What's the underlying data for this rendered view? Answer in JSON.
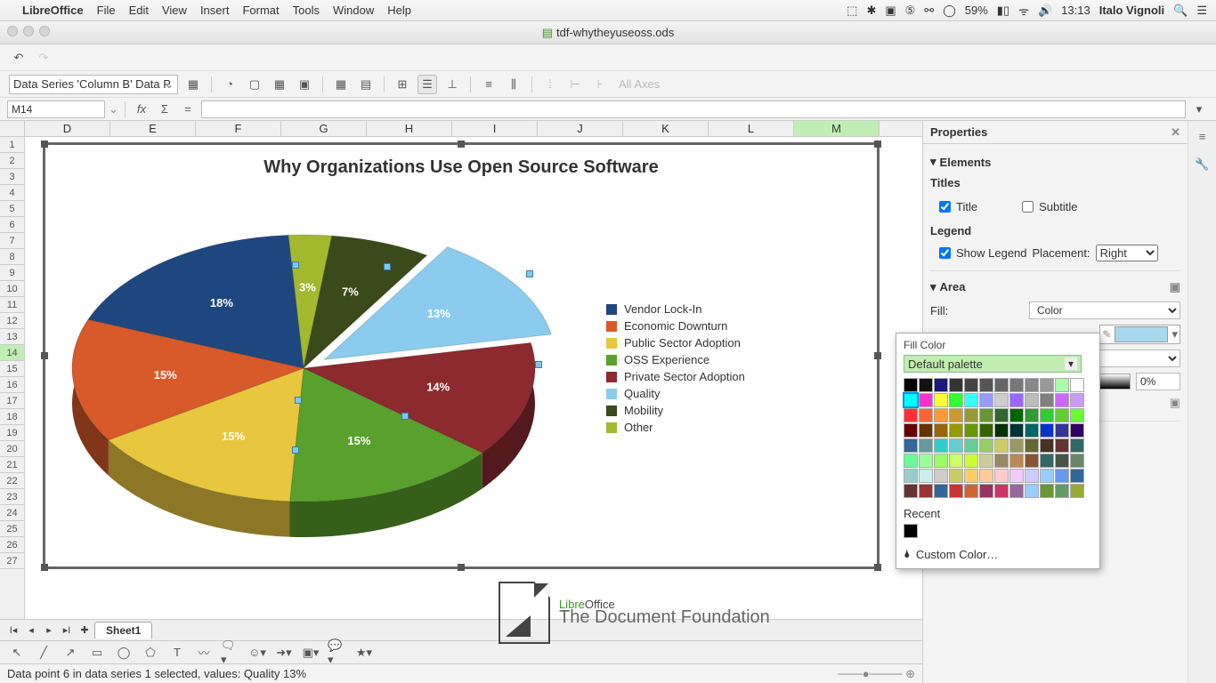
{
  "mac_menu": {
    "app": "LibreOffice",
    "items": [
      "File",
      "Edit",
      "View",
      "Insert",
      "Format",
      "Tools",
      "Window",
      "Help"
    ],
    "battery": "59%",
    "clock": "13:13",
    "user": "Italo Vignoli"
  },
  "window": {
    "title": "tdf-whytheyuseoss.ods"
  },
  "toolbar": {
    "series_combo": "Data Series 'Column B' Data P",
    "axes_label": "All Axes"
  },
  "cellref": {
    "cell": "M14"
  },
  "columns": [
    "D",
    "E",
    "F",
    "G",
    "H",
    "I",
    "J",
    "K",
    "L",
    "M"
  ],
  "active_col": "M",
  "rows_count": 27,
  "active_row": 14,
  "sidebar": {
    "header": "Properties",
    "elements": "Elements",
    "titles": "Titles",
    "title_cb": "Title",
    "subtitle_cb": "Subtitle",
    "legend": "Legend",
    "show_legend_cb": "Show Legend",
    "placement_lbl": "Placement:",
    "placement_val": "Right",
    "area": "Area",
    "fill_lbl": "Fill:",
    "fill_mode": "Color",
    "transparency_val": "0%"
  },
  "popup": {
    "header": "Fill Color",
    "palette": "Default palette",
    "recent": "Recent",
    "custom": "Custom Color…"
  },
  "tabs": {
    "sheet": "Sheet1"
  },
  "status": "Data point 6 in data series 1 selected, values: Quality 13%",
  "logo": {
    "name": "LibreOffice",
    "sub": "The Document Foundation"
  },
  "chart_data": {
    "type": "pie",
    "title": "Why Organizations Use Open Source Software",
    "categories": [
      "Vendor Lock-In",
      "Economic Downturn",
      "Public Sector Adoption",
      "OSS Experience",
      "Private Sector Adoption",
      "Quality",
      "Mobility",
      "Other"
    ],
    "values": [
      18,
      15,
      15,
      15,
      14,
      13,
      7,
      3
    ],
    "labels": [
      "18%",
      "15%",
      "15%",
      "15%",
      "14%",
      "13%",
      "7%",
      "3%"
    ],
    "colors": [
      "#1f477f",
      "#d85a2b",
      "#e8c73e",
      "#5aa02c",
      "#8c2a2f",
      "#8bccee",
      "#3a4a1a",
      "#a2b92e"
    ],
    "selected_index": 5
  },
  "palette_colors": [
    "#000000",
    "#111111",
    "#1a1a7a",
    "#333333",
    "#444444",
    "#555555",
    "#666666",
    "#777777",
    "#888888",
    "#999999",
    "#aaffaa",
    "#ffffff",
    "#00ffff",
    "#ff33cc",
    "#ffff33",
    "#33ff33",
    "#33ffff",
    "#9999ff",
    "#cccccc",
    "#9966ff",
    "#bbbbbb",
    "#808080",
    "#cc66ff",
    "#cc99ff",
    "#ff3333",
    "#ff6633",
    "#ff9933",
    "#cc9933",
    "#999933",
    "#669933",
    "#336633",
    "#006600",
    "#339933",
    "#33cc33",
    "#66cc33",
    "#66ff33",
    "#660000",
    "#663300",
    "#996600",
    "#999900",
    "#669900",
    "#336600",
    "#003300",
    "#003333",
    "#006666",
    "#0033cc",
    "#333399",
    "#330066",
    "#336699",
    "#669999",
    "#33cccc",
    "#66cccc",
    "#66cc99",
    "#99cc66",
    "#cccc66",
    "#999966",
    "#666633",
    "#443322",
    "#663333",
    "#336666",
    "#66ff99",
    "#99ff99",
    "#99ff66",
    "#ccff66",
    "#ccff33",
    "#cccc99",
    "#998866",
    "#bb8855",
    "#885533",
    "#336666",
    "#445544",
    "#668866",
    "#99cccc",
    "#cceeee",
    "#cccccc",
    "#cccc66",
    "#ffcc66",
    "#ffcc99",
    "#ffcccc",
    "#eeccff",
    "#ccccff",
    "#99ccff",
    "#6699ee",
    "#336699",
    "#663333",
    "#993333",
    "#336699",
    "#cc3333",
    "#cc6633",
    "#993366",
    "#cc3366",
    "#996699",
    "#99ccff",
    "#669933",
    "#669966",
    "#99aa33"
  ]
}
